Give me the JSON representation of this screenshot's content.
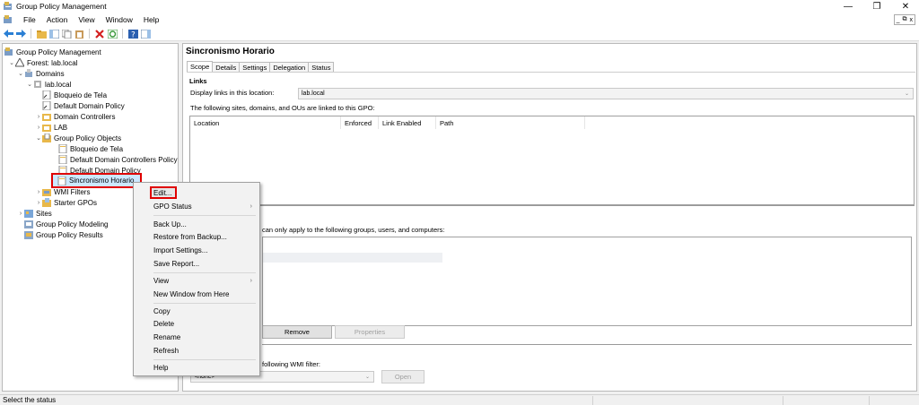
{
  "window": {
    "title": "Group Policy Management",
    "minimize": "—",
    "restore": "❐",
    "close": "✕"
  },
  "menu": {
    "items": [
      "File",
      "Action",
      "View",
      "Window",
      "Help"
    ],
    "mdi_min": "_",
    "mdi_restore": "⧉",
    "mdi_close": "x"
  },
  "tree": {
    "root": "Group Policy Management",
    "forest": "Forest: lab.local",
    "domains": "Domains",
    "domain": "lab.local",
    "items": [
      "Bloqueio de Tela",
      "Default Domain Policy",
      "Domain Controllers",
      "LAB",
      "Group Policy Objects"
    ],
    "gpos": [
      "Bloqueio de Tela",
      "Default Domain Controllers Policy",
      "Default Domain Policy",
      "Sincronismo Horario"
    ],
    "wmi": "WMI Filters",
    "starter": "Starter GPOs",
    "sites": "Sites",
    "modeling": "Group Policy Modeling",
    "results": "Group Policy Results"
  },
  "gpo": {
    "name": "Sincronismo Horario",
    "tabs": [
      "Scope",
      "Details",
      "Settings",
      "Delegation",
      "Status"
    ],
    "links_heading": "Links",
    "display_links_label": "Display links in this location:",
    "display_links_value": "lab.local",
    "linked_text": "The following sites, domains, and OUs are linked to this GPO:",
    "columns": [
      "Location",
      "Enforced",
      "Link Enabled",
      "Path"
    ],
    "filtering_text": "can only apply to the following groups, users, and computers:",
    "remove": "Remove",
    "properties": "Properties",
    "wmi_text": "following WMI filter:",
    "wmi_value": "<none>",
    "open": "Open"
  },
  "context_menu": {
    "items": [
      "Edit...",
      "GPO Status",
      "Back Up...",
      "Restore from Backup...",
      "Import Settings...",
      "Save Report...",
      "View",
      "New Window from Here",
      "Copy",
      "Delete",
      "Rename",
      "Refresh",
      "Help"
    ],
    "submenu_arrow": "›"
  },
  "status": {
    "text": "Select the status"
  },
  "colors": {
    "highlight": "#e00000",
    "selection": "#cce8ff"
  }
}
